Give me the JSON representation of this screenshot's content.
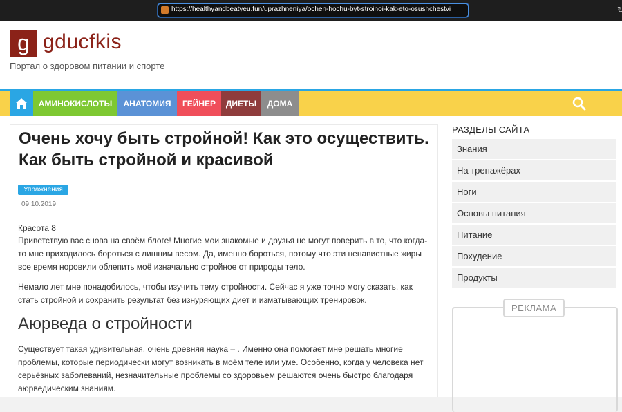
{
  "browser": {
    "url": "https://healthyandbeatyeu.fun/uprazhneniya/ochen-hochu-byt-stroinoi-kak-eto-osushchestvi"
  },
  "site": {
    "logo_letter": "g",
    "name": "gducfkis",
    "tagline": "Портал о здоровом питании и спорте"
  },
  "nav": {
    "items": [
      {
        "label": "АМИНОКИСЛОТЫ",
        "color": "#7ec832"
      },
      {
        "label": "АНАТОМИЯ",
        "color": "#5b92d6"
      },
      {
        "label": "ГЕЙНЕР",
        "color": "#f04e5a"
      },
      {
        "label": "ДИЕТЫ",
        "color": "#8f3c3c"
      },
      {
        "label": "ДОМА",
        "color": "#8d8d8d"
      }
    ]
  },
  "article": {
    "title": "Очень хочу быть стройной! Как это осуществить. Как быть стройной и красивой",
    "category": "Упражнения",
    "date": "09.10.2019",
    "intro_label": "Красота 8",
    "p1": "Приветствую вас снова на своём блоге! Многие мои знакомые и друзья не могут поверить в то, что когда-то мне приходилось бороться с лишним весом. Да, именно бороться, потому что эти ненавистные жиры все время норовили облепить моё изначально стройное от природы тело.",
    "p2": "Немало лет мне понадобилось, чтобы изучить тему стройности. Сейчас я уже точно могу сказать, как стать стройной и сохранить результат без изнуряющих диет и изматывающих тренировок.",
    "h2": "Аюрведа о стройности",
    "p3": "Существует такая удивительная, очень древняя наука – . Именно она помогает мне решать многие проблемы, которые периодически могут возникать в моём теле или уме. Особенно, когда у человека нет серьёзных заболеваний, незначительные проблемы со здоровьем решаются очень быстро благодаря аюрведическим знаниям."
  },
  "sidebar": {
    "title": "РАЗДЕЛЫ САЙТА",
    "items": [
      "Знания",
      "На тренажёрах",
      "Ноги",
      "Основы питания",
      "Питание",
      "Похудение",
      "Продукты"
    ],
    "ad_label": "РЕКЛАМА"
  }
}
